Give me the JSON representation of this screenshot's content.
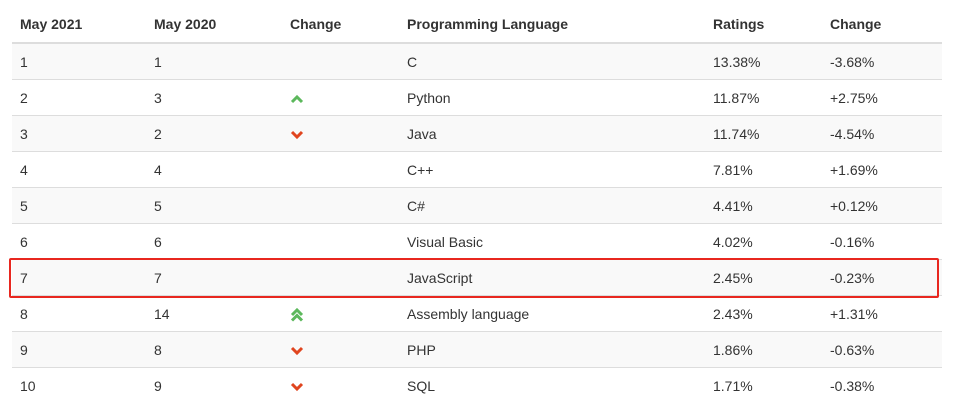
{
  "headers": {
    "may2021": "May 2021",
    "may2020": "May 2020",
    "change_trend": "Change",
    "language": "Programming Language",
    "ratings": "Ratings",
    "change": "Change"
  },
  "rows": [
    {
      "rank2021": "1",
      "rank2020": "1",
      "trend": "none",
      "language": "C",
      "rating": "13.38%",
      "change": "-3.68%"
    },
    {
      "rank2021": "2",
      "rank2020": "3",
      "trend": "up",
      "language": "Python",
      "rating": "11.87%",
      "change": "+2.75%"
    },
    {
      "rank2021": "3",
      "rank2020": "2",
      "trend": "down",
      "language": "Java",
      "rating": "11.74%",
      "change": "-4.54%"
    },
    {
      "rank2021": "4",
      "rank2020": "4",
      "trend": "none",
      "language": "C++",
      "rating": "7.81%",
      "change": "+1.69%"
    },
    {
      "rank2021": "5",
      "rank2020": "5",
      "trend": "none",
      "language": "C#",
      "rating": "4.41%",
      "change": "+0.12%"
    },
    {
      "rank2021": "6",
      "rank2020": "6",
      "trend": "none",
      "language": "Visual Basic",
      "rating": "4.02%",
      "change": "-0.16%"
    },
    {
      "rank2021": "7",
      "rank2020": "7",
      "trend": "none",
      "language": "JavaScript",
      "rating": "2.45%",
      "change": "-0.23%"
    },
    {
      "rank2021": "8",
      "rank2020": "14",
      "trend": "double-up",
      "language": "Assembly language",
      "rating": "2.43%",
      "change": "+1.31%"
    },
    {
      "rank2021": "9",
      "rank2020": "8",
      "trend": "down",
      "language": "PHP",
      "rating": "1.86%",
      "change": "-0.63%"
    },
    {
      "rank2021": "10",
      "rank2020": "9",
      "trend": "down",
      "language": "SQL",
      "rating": "1.71%",
      "change": "-0.38%"
    }
  ],
  "highlighted_row_index": 6,
  "colors": {
    "up": "#5cb85c",
    "down": "#e0451f",
    "highlight_border": "#e8271f"
  },
  "icons": {
    "up": "chevron-up-icon",
    "double-up": "double-chevron-up-icon",
    "down": "chevron-down-icon"
  }
}
